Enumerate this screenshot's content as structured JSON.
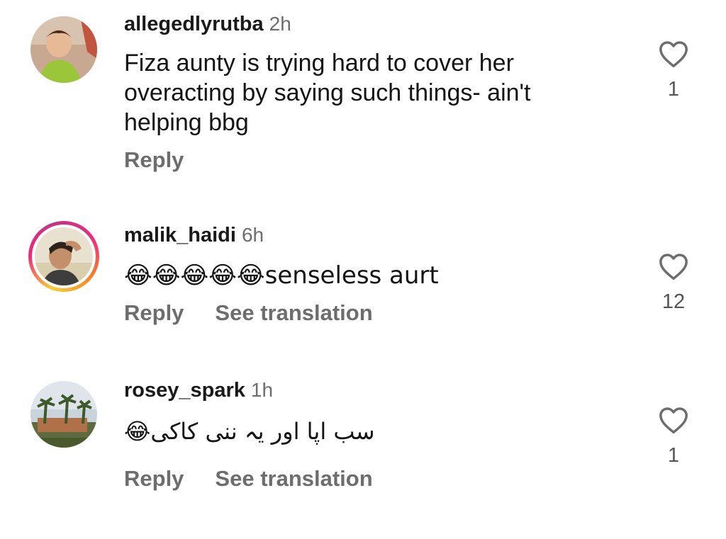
{
  "comments": [
    {
      "username": "allegedlyrutba",
      "time": "2h",
      "text": "Fiza aunty is trying hard to cover her overacting by saying such things- ain't helping bbg",
      "reply_label": "Reply",
      "like_count": "1",
      "has_story": false,
      "has_translation": false
    },
    {
      "username": "malik_haidi",
      "time": "6h",
      "text": "😂😂😂😂😂senseless aurt",
      "reply_label": "Reply",
      "translation_label": "See translation",
      "like_count": "12",
      "has_story": true,
      "has_translation": true
    },
    {
      "username": "rosey_spark",
      "time": "1h",
      "text": "سب اپا اور یہ ننی کاکی😂",
      "reply_label": "Reply",
      "translation_label": "See translation",
      "like_count": "1",
      "has_story": false,
      "has_translation": true
    }
  ],
  "icons": {
    "like": "heart-outline-icon"
  },
  "colors": {
    "username": "#1a1a1a",
    "secondary_text": "#6d6d6d",
    "story_ring_start": "#f9ce34",
    "story_ring_mid": "#ee2a7b",
    "story_ring_end": "#c13584"
  }
}
